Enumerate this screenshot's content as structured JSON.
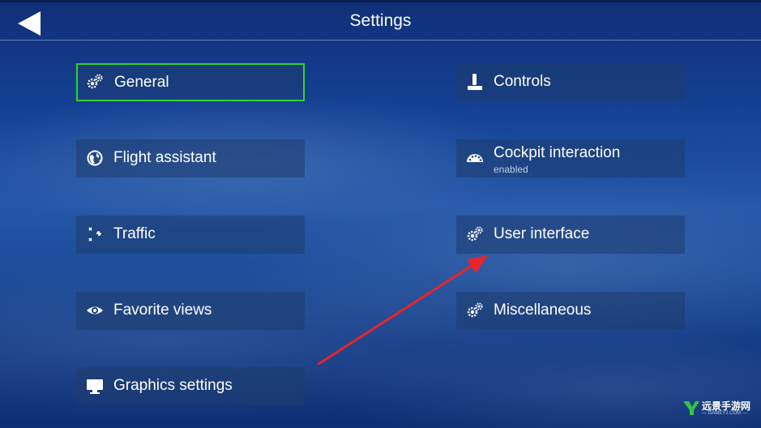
{
  "header": {
    "title": "Settings",
    "back_icon": "back-arrow-icon"
  },
  "menu": {
    "left": [
      {
        "label": "General",
        "icon": "gears-icon",
        "selected": true
      },
      {
        "label": "Flight assistant",
        "icon": "globe-icon"
      },
      {
        "label": "Traffic",
        "icon": "traffic-planes-icon"
      },
      {
        "label": "Favorite views",
        "icon": "eye-icon"
      },
      {
        "label": "Graphics settings",
        "icon": "monitor-icon"
      }
    ],
    "right": [
      {
        "label": "Controls",
        "icon": "joystick-icon"
      },
      {
        "label": "Cockpit interaction",
        "sublabel": "enabled",
        "icon": "gauge-icon"
      },
      {
        "label": "User interface",
        "icon": "gears-icon"
      },
      {
        "label": "Miscellaneous",
        "icon": "gears-icon"
      }
    ]
  },
  "annotation": {
    "arrow_color": "#e8242a"
  },
  "watermark": {
    "brand": "远景手游网",
    "url": "— GAMEYJ.COM —"
  },
  "colors": {
    "selected_border": "#32d232",
    "tile_bg": "rgba(30,60,110,0.55)",
    "text": "#ffffff"
  }
}
